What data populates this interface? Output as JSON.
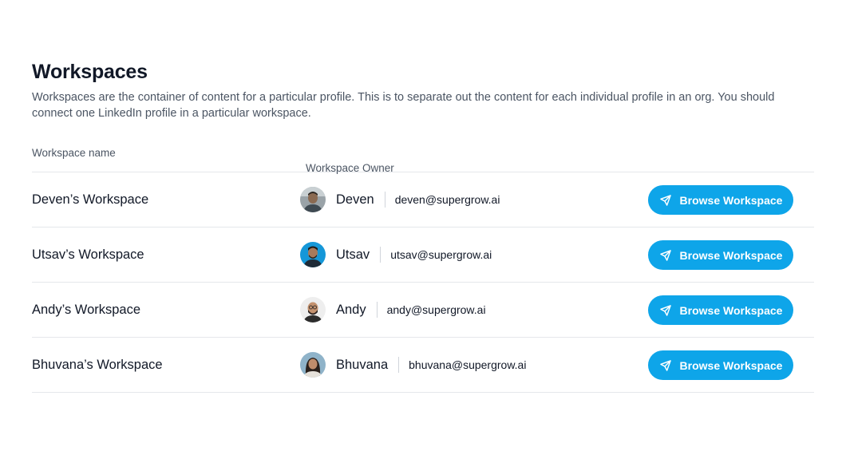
{
  "page": {
    "title": "Workspaces",
    "description": "Workspaces are the container of content for a particular profile. This is to separate out the content for each individual profile in an org. You should connect one LinkedIn profile in a particular workspace."
  },
  "table": {
    "headers": {
      "name": "Workspace name",
      "owner": "Workspace Owner"
    },
    "rows": [
      {
        "workspace": "Deven’s Workspace",
        "owner_name": "Deven",
        "owner_email": "deven@supergrow.ai",
        "button": "Browse Workspace",
        "button_icon": "send-icon"
      },
      {
        "workspace": "Utsav’s Workspace",
        "owner_name": "Utsav",
        "owner_email": "utsav@supergrow.ai",
        "button": "Browse Workspace",
        "button_icon": "send-icon"
      },
      {
        "workspace": "Andy’s Workspace",
        "owner_name": "Andy",
        "owner_email": "andy@supergrow.ai",
        "button": "Browse Workspace",
        "button_icon": "send-icon"
      },
      {
        "workspace": "Bhuvana’s Workspace",
        "owner_name": "Bhuvana",
        "owner_email": "bhuvana@supergrow.ai",
        "button": "Browse Workspace",
        "button_icon": "send-icon"
      }
    ]
  },
  "colors": {
    "accent": "#0ea5e9",
    "divider": "#e5e7eb",
    "text": "#111827",
    "muted": "#4b5563"
  }
}
